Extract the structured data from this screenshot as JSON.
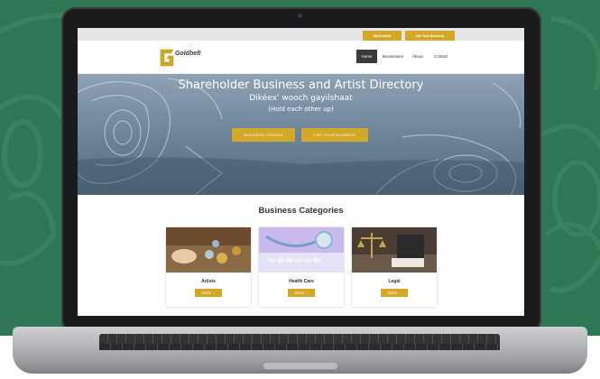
{
  "colors": {
    "background": "#2f7654",
    "accent": "#d4a826",
    "nav_active": "#3a3a3a"
  },
  "site": {
    "logo_text": "Goldbelt",
    "topbar": {
      "btn1": "MyGoldbelt",
      "btn2": "Add Your Business"
    },
    "nav": {
      "home": "Home",
      "businesses": "Businesses",
      "about": "About",
      "contact": "Contact"
    }
  },
  "hero": {
    "title": "Shareholder Business and Artist Directory",
    "subtitle": "Dikéex' wooch gayilshaat",
    "subtitle2": "(Hold each other up)",
    "buttons": {
      "listings": "BUSINESS LISTINGS",
      "list": "LIST YOUR BUSINESS"
    }
  },
  "categories": {
    "title": "Business Categories",
    "items": [
      {
        "label": "Artists",
        "button": "MORE →"
      },
      {
        "label": "Health Care",
        "button": "MORE →"
      },
      {
        "label": "Legal",
        "button": "MORE →"
      }
    ]
  }
}
